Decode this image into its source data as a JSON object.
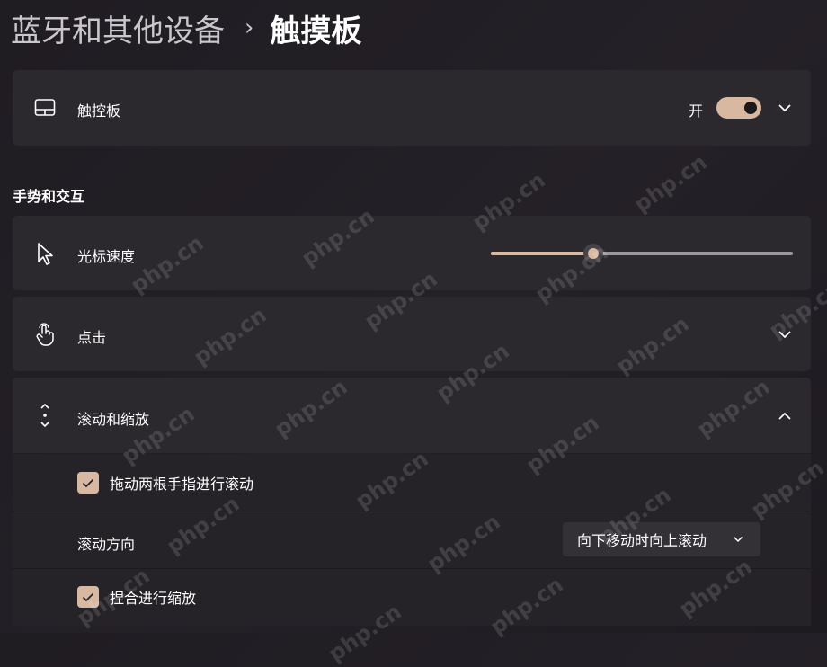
{
  "breadcrumb": {
    "parent": "蓝牙和其他设备",
    "separator": "›",
    "current": "触摸板"
  },
  "touchpad": {
    "label": "触控板",
    "toggle_text": "开",
    "toggle_on": true,
    "icon": "touchpad-icon"
  },
  "section": {
    "title": "手势和交互"
  },
  "cursor_speed": {
    "label": "光标速度",
    "icon": "cursor-icon",
    "value_fraction": 0.34
  },
  "tap": {
    "label": "点击",
    "icon": "tap-hand-icon"
  },
  "scroll_zoom": {
    "label": "滚动和缩放",
    "icon": "scroll-icon",
    "expanded": true,
    "drag_two_fingers": {
      "label": "拖动两根手指进行滚动",
      "checked": true
    },
    "scroll_direction": {
      "label": "滚动方向",
      "selected": "向下移动时向上滚动"
    },
    "pinch_zoom": {
      "label": "捏合进行缩放",
      "checked": true
    }
  },
  "watermark": "php.cn",
  "colors": {
    "accent": "#d9b8a2",
    "card": "#2b282e",
    "background": "#221f25"
  }
}
